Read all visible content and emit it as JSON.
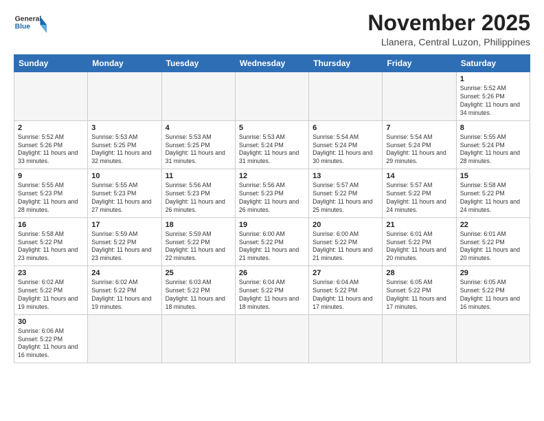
{
  "header": {
    "logo_general": "General",
    "logo_blue": "Blue",
    "month_title": "November 2025",
    "location": "Llanera, Central Luzon, Philippines"
  },
  "days_of_week": [
    "Sunday",
    "Monday",
    "Tuesday",
    "Wednesday",
    "Thursday",
    "Friday",
    "Saturday"
  ],
  "weeks": [
    [
      {
        "day": "",
        "empty": true
      },
      {
        "day": "",
        "empty": true
      },
      {
        "day": "",
        "empty": true
      },
      {
        "day": "",
        "empty": true
      },
      {
        "day": "",
        "empty": true
      },
      {
        "day": "",
        "empty": true
      },
      {
        "day": "1",
        "sunrise": "Sunrise: 5:52 AM",
        "sunset": "Sunset: 5:26 PM",
        "daylight": "Daylight: 11 hours and 34 minutes."
      }
    ],
    [
      {
        "day": "2",
        "sunrise": "Sunrise: 5:52 AM",
        "sunset": "Sunset: 5:26 PM",
        "daylight": "Daylight: 11 hours and 33 minutes."
      },
      {
        "day": "3",
        "sunrise": "Sunrise: 5:53 AM",
        "sunset": "Sunset: 5:25 PM",
        "daylight": "Daylight: 11 hours and 32 minutes."
      },
      {
        "day": "4",
        "sunrise": "Sunrise: 5:53 AM",
        "sunset": "Sunset: 5:25 PM",
        "daylight": "Daylight: 11 hours and 31 minutes."
      },
      {
        "day": "5",
        "sunrise": "Sunrise: 5:53 AM",
        "sunset": "Sunset: 5:24 PM",
        "daylight": "Daylight: 11 hours and 31 minutes."
      },
      {
        "day": "6",
        "sunrise": "Sunrise: 5:54 AM",
        "sunset": "Sunset: 5:24 PM",
        "daylight": "Daylight: 11 hours and 30 minutes."
      },
      {
        "day": "7",
        "sunrise": "Sunrise: 5:54 AM",
        "sunset": "Sunset: 5:24 PM",
        "daylight": "Daylight: 11 hours and 29 minutes."
      },
      {
        "day": "8",
        "sunrise": "Sunrise: 5:55 AM",
        "sunset": "Sunset: 5:24 PM",
        "daylight": "Daylight: 11 hours and 28 minutes."
      }
    ],
    [
      {
        "day": "9",
        "sunrise": "Sunrise: 5:55 AM",
        "sunset": "Sunset: 5:23 PM",
        "daylight": "Daylight: 11 hours and 28 minutes."
      },
      {
        "day": "10",
        "sunrise": "Sunrise: 5:55 AM",
        "sunset": "Sunset: 5:23 PM",
        "daylight": "Daylight: 11 hours and 27 minutes."
      },
      {
        "day": "11",
        "sunrise": "Sunrise: 5:56 AM",
        "sunset": "Sunset: 5:23 PM",
        "daylight": "Daylight: 11 hours and 26 minutes."
      },
      {
        "day": "12",
        "sunrise": "Sunrise: 5:56 AM",
        "sunset": "Sunset: 5:23 PM",
        "daylight": "Daylight: 11 hours and 26 minutes."
      },
      {
        "day": "13",
        "sunrise": "Sunrise: 5:57 AM",
        "sunset": "Sunset: 5:22 PM",
        "daylight": "Daylight: 11 hours and 25 minutes."
      },
      {
        "day": "14",
        "sunrise": "Sunrise: 5:57 AM",
        "sunset": "Sunset: 5:22 PM",
        "daylight": "Daylight: 11 hours and 24 minutes."
      },
      {
        "day": "15",
        "sunrise": "Sunrise: 5:58 AM",
        "sunset": "Sunset: 5:22 PM",
        "daylight": "Daylight: 11 hours and 24 minutes."
      }
    ],
    [
      {
        "day": "16",
        "sunrise": "Sunrise: 5:58 AM",
        "sunset": "Sunset: 5:22 PM",
        "daylight": "Daylight: 11 hours and 23 minutes."
      },
      {
        "day": "17",
        "sunrise": "Sunrise: 5:59 AM",
        "sunset": "Sunset: 5:22 PM",
        "daylight": "Daylight: 11 hours and 23 minutes."
      },
      {
        "day": "18",
        "sunrise": "Sunrise: 5:59 AM",
        "sunset": "Sunset: 5:22 PM",
        "daylight": "Daylight: 11 hours and 22 minutes."
      },
      {
        "day": "19",
        "sunrise": "Sunrise: 6:00 AM",
        "sunset": "Sunset: 5:22 PM",
        "daylight": "Daylight: 11 hours and 21 minutes."
      },
      {
        "day": "20",
        "sunrise": "Sunrise: 6:00 AM",
        "sunset": "Sunset: 5:22 PM",
        "daylight": "Daylight: 11 hours and 21 minutes."
      },
      {
        "day": "21",
        "sunrise": "Sunrise: 6:01 AM",
        "sunset": "Sunset: 5:22 PM",
        "daylight": "Daylight: 11 hours and 20 minutes."
      },
      {
        "day": "22",
        "sunrise": "Sunrise: 6:01 AM",
        "sunset": "Sunset: 5:22 PM",
        "daylight": "Daylight: 11 hours and 20 minutes."
      }
    ],
    [
      {
        "day": "23",
        "sunrise": "Sunrise: 6:02 AM",
        "sunset": "Sunset: 5:22 PM",
        "daylight": "Daylight: 11 hours and 19 minutes."
      },
      {
        "day": "24",
        "sunrise": "Sunrise: 6:02 AM",
        "sunset": "Sunset: 5:22 PM",
        "daylight": "Daylight: 11 hours and 19 minutes."
      },
      {
        "day": "25",
        "sunrise": "Sunrise: 6:03 AM",
        "sunset": "Sunset: 5:22 PM",
        "daylight": "Daylight: 11 hours and 18 minutes."
      },
      {
        "day": "26",
        "sunrise": "Sunrise: 6:04 AM",
        "sunset": "Sunset: 5:22 PM",
        "daylight": "Daylight: 11 hours and 18 minutes."
      },
      {
        "day": "27",
        "sunrise": "Sunrise: 6:04 AM",
        "sunset": "Sunset: 5:22 PM",
        "daylight": "Daylight: 11 hours and 17 minutes."
      },
      {
        "day": "28",
        "sunrise": "Sunrise: 6:05 AM",
        "sunset": "Sunset: 5:22 PM",
        "daylight": "Daylight: 11 hours and 17 minutes."
      },
      {
        "day": "29",
        "sunrise": "Sunrise: 6:05 AM",
        "sunset": "Sunset: 5:22 PM",
        "daylight": "Daylight: 11 hours and 16 minutes."
      }
    ],
    [
      {
        "day": "30",
        "sunrise": "Sunrise: 6:06 AM",
        "sunset": "Sunset: 5:22 PM",
        "daylight": "Daylight: 11 hours and 16 minutes."
      },
      {
        "day": "",
        "empty": true
      },
      {
        "day": "",
        "empty": true
      },
      {
        "day": "",
        "empty": true
      },
      {
        "day": "",
        "empty": true
      },
      {
        "day": "",
        "empty": true
      },
      {
        "day": "",
        "empty": true
      }
    ]
  ]
}
